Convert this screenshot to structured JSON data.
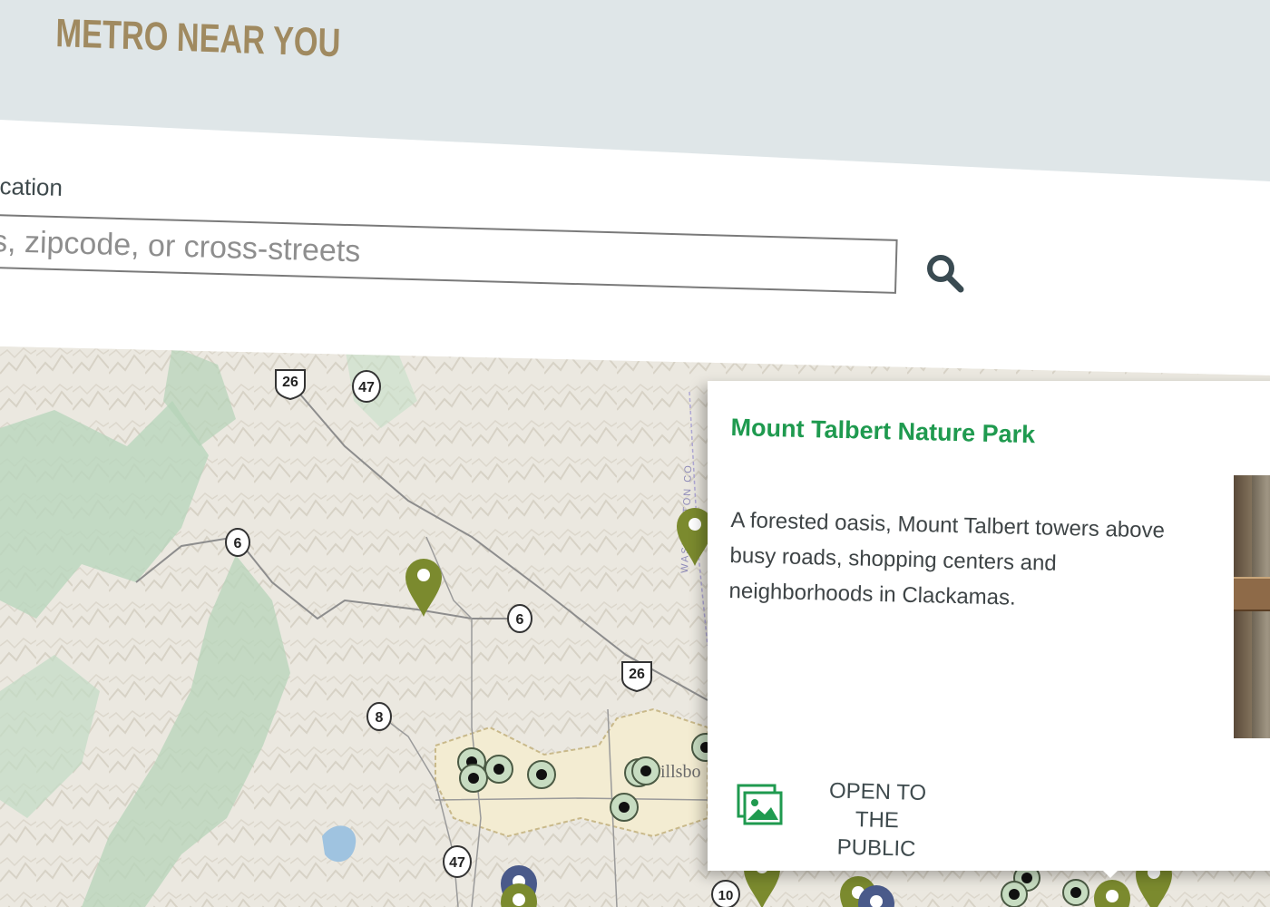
{
  "header": {
    "title": "METRO NEAR YOU"
  },
  "search": {
    "label": "cation",
    "placeholder": "s, zipcode, or cross-streets",
    "button_icon": "search-icon"
  },
  "map": {
    "route_shields": [
      "26",
      "47",
      "6",
      "6",
      "26",
      "8",
      "47",
      "10"
    ],
    "place_label": "illsbo",
    "vertical_label": "WASHINGTON CO",
    "colors": {
      "pin_green": "#7b8a2e",
      "pin_blue": "#4a5a8a",
      "poi_ring": "#4b5a44",
      "city_fill": "#f3ecd2",
      "city_border": "#c9b98a"
    }
  },
  "popup": {
    "title": "Mount Talbert Nature Park",
    "description": "A forested oasis, Mount Talbert towers above busy roads, shopping centers and neighborhoods in Clackamas.",
    "status_line_1": "OPEN TO",
    "status_line_2": "THE PUBLIC",
    "gallery_icon": "photo-gallery-icon",
    "colors": {
      "title": "#1f9a4f",
      "icon": "#1f9a4f"
    }
  }
}
